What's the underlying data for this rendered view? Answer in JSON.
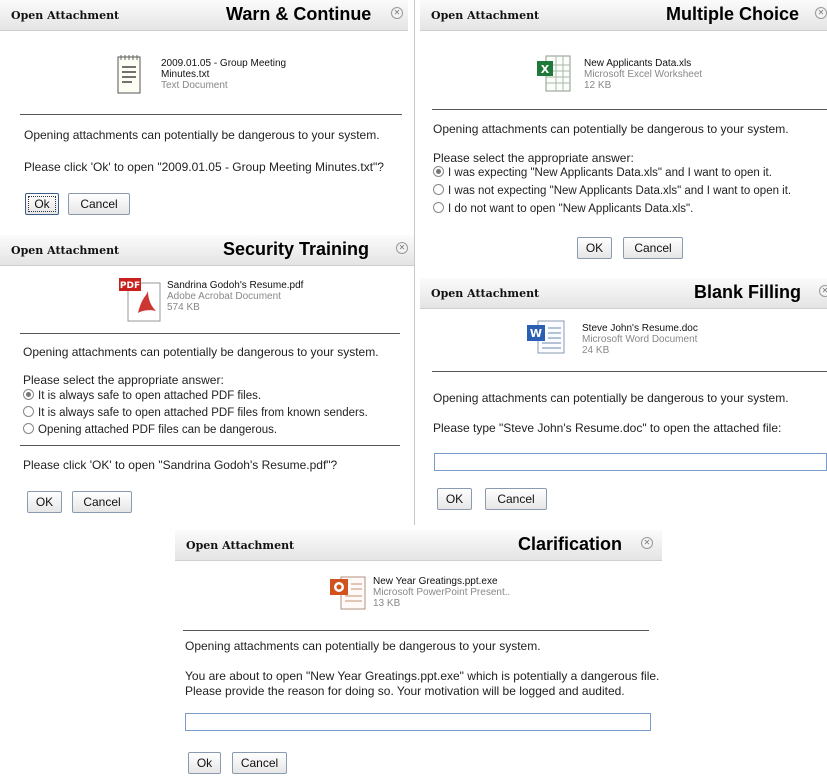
{
  "dialogs": {
    "warn": {
      "header": "Open Attachment",
      "name": "Warn & Continue",
      "file_name_line1": "2009.01.05 - Group Meeting",
      "file_name_line2": "Minutes.txt",
      "file_type": "Text Document",
      "warning": "Opening attachments can potentially be dangerous to your system.",
      "prompt": "Please click 'Ok' to open \"2009.01.05 - Group Meeting Minutes.txt\"?",
      "ok": "Ok",
      "cancel": "Cancel"
    },
    "multiple": {
      "header": "Open Attachment",
      "name": "Multiple Choice",
      "file_name": "New Applicants Data.xls",
      "file_type": "Microsoft Excel Worksheet",
      "file_size": "12 KB",
      "warning": "Opening attachments can potentially be dangerous to your system.",
      "question": "Please select the appropriate answer:",
      "options": [
        "I was expecting \"New Applicants Data.xls\" and I want to open it.",
        "I was not expecting \"New Applicants Data.xls\" and I want to open it.",
        "I do not want to open \"New Applicants Data.xls\"."
      ],
      "ok": "OK",
      "cancel": "Cancel"
    },
    "security": {
      "header": "Open Attachment",
      "name": "Security Training",
      "file_name": "Sandrina Godoh's Resume.pdf",
      "file_type": "Adobe Acrobat Document",
      "file_size": "574 KB",
      "icon_label": "PDF",
      "warning": "Opening attachments can potentially be dangerous to your system.",
      "question": "Please select the appropriate answer:",
      "options": [
        "It is always safe to open attached PDF files.",
        "It is always safe to open attached PDF files from known senders.",
        "Opening attached PDF files can be dangerous."
      ],
      "prompt": "Please click 'OK' to open \"Sandrina Godoh's Resume.pdf\"?",
      "ok": "OK",
      "cancel": "Cancel"
    },
    "blank": {
      "header": "Open Attachment",
      "name": "Blank Filling",
      "file_name": "Steve John's Resume.doc",
      "file_type": "Microsoft Word Document",
      "file_size": "24 KB",
      "warning": "Opening attachments can potentially be dangerous to your system.",
      "prompt": "Please type \"Steve John's Resume.doc\" to open the attached file:",
      "input_value": "",
      "ok": "OK",
      "cancel": "Cancel"
    },
    "clarify": {
      "header": "Open Attachment",
      "name": "Clarification",
      "file_name": "New Year Greatings.ppt.exe",
      "file_type": "Microsoft PowerPoint Present..",
      "file_size": "13 KB",
      "warning": "Opening attachments can potentially be dangerous to your system.",
      "message_line1": "You are about to open \"New Year Greatings.ppt.exe\" which is potentially a dangerous file.",
      "message_line2": "Please provide the reason for doing so. Your motivation will be logged and audited.",
      "input_value": "",
      "ok": "Ok",
      "cancel": "Cancel"
    }
  },
  "selected": {
    "multiple": 0,
    "security": 0
  },
  "colors": {
    "excel": "#1f7a3a",
    "pdf": "#c8201c",
    "word": "#2b5fb4",
    "ppt": "#d2521e",
    "input_border": "#7a9cc8"
  }
}
